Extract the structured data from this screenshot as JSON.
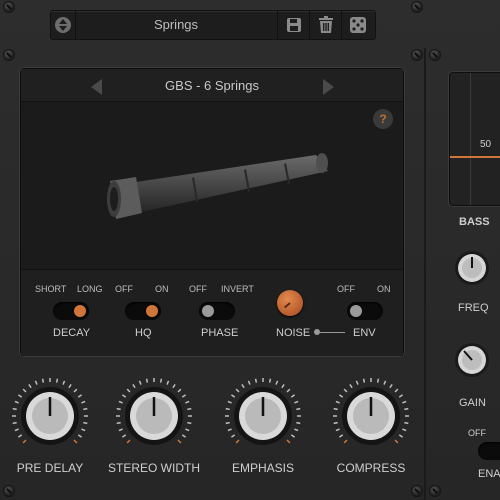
{
  "preset": {
    "name": "Springs"
  },
  "spring_panel": {
    "title": "GBS - 6 Springs",
    "help": "?"
  },
  "switches": [
    {
      "id": "decay",
      "left_label": "SHORT",
      "right_label": "LONG",
      "label": "DECAY",
      "state": "right",
      "color": "#d1763a"
    },
    {
      "id": "hq",
      "left_label": "OFF",
      "right_label": "ON",
      "label": "HQ",
      "state": "right",
      "color": "#d1763a"
    },
    {
      "id": "phase",
      "left_label": "OFF",
      "right_label": "INVERT",
      "label": "PHASE",
      "state": "left",
      "color": "#9a9a9a"
    },
    {
      "id": "env",
      "left_label": "OFF",
      "right_label": "ON",
      "label": "ENV",
      "state": "left",
      "color": "#9a9a9a"
    }
  ],
  "noise": {
    "label": "NOISE",
    "accent": "#d1763a"
  },
  "knobs": [
    {
      "id": "pre-delay",
      "label": "PRE DELAY"
    },
    {
      "id": "stereo-width",
      "label": "STEREO WIDTH"
    },
    {
      "id": "emphasis",
      "label": "EMPHASIS"
    },
    {
      "id": "compress",
      "label": "COMPRESS"
    }
  ],
  "right": {
    "eq_value": "50",
    "section": "BASS",
    "freq_label": "FREQ",
    "gain_label": "GAIN",
    "off_label": "OFF",
    "ena_label": "ENA"
  },
  "icons": [
    "up-down-arrows-icon",
    "save-icon",
    "trash-icon",
    "dice-icon",
    "help-icon"
  ]
}
